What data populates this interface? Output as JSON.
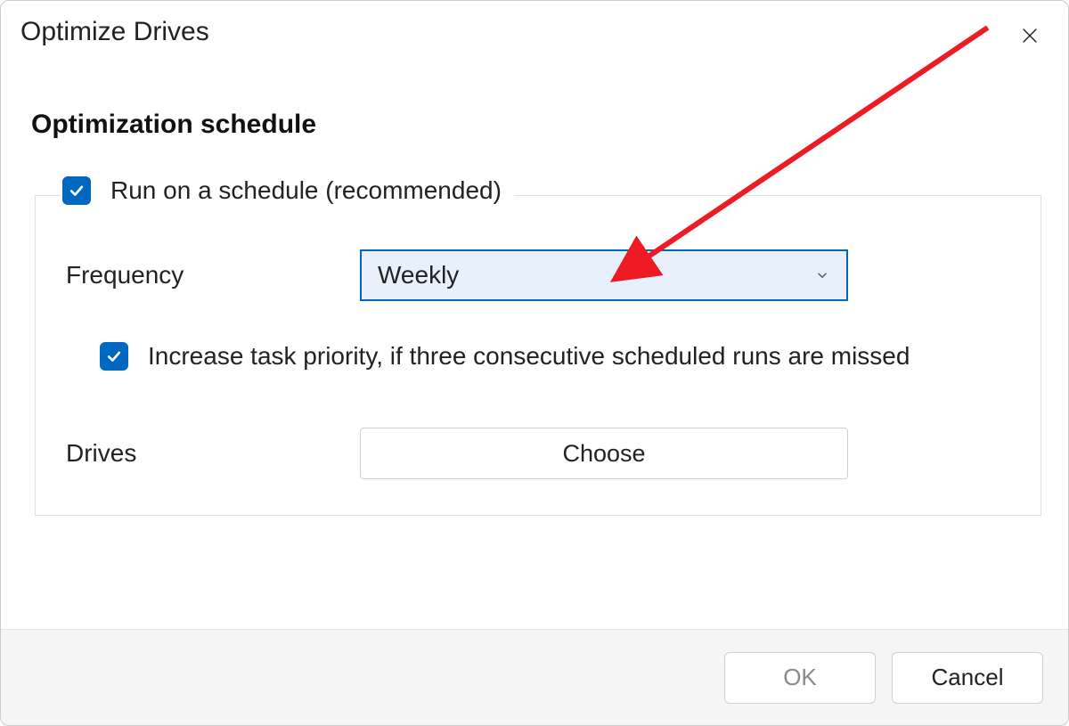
{
  "dialog": {
    "title": "Optimize Drives",
    "section_heading": "Optimization schedule",
    "run_on_schedule": {
      "checked": true,
      "label": "Run on a schedule (recommended)"
    },
    "frequency": {
      "label": "Frequency",
      "selected": "Weekly"
    },
    "increase_priority": {
      "checked": true,
      "label": "Increase task priority, if three consecutive scheduled runs are missed"
    },
    "drives": {
      "label": "Drives",
      "button": "Choose"
    },
    "footer": {
      "ok": "OK",
      "cancel": "Cancel"
    }
  },
  "annotation": {
    "arrow_color": "#ed1c24"
  }
}
